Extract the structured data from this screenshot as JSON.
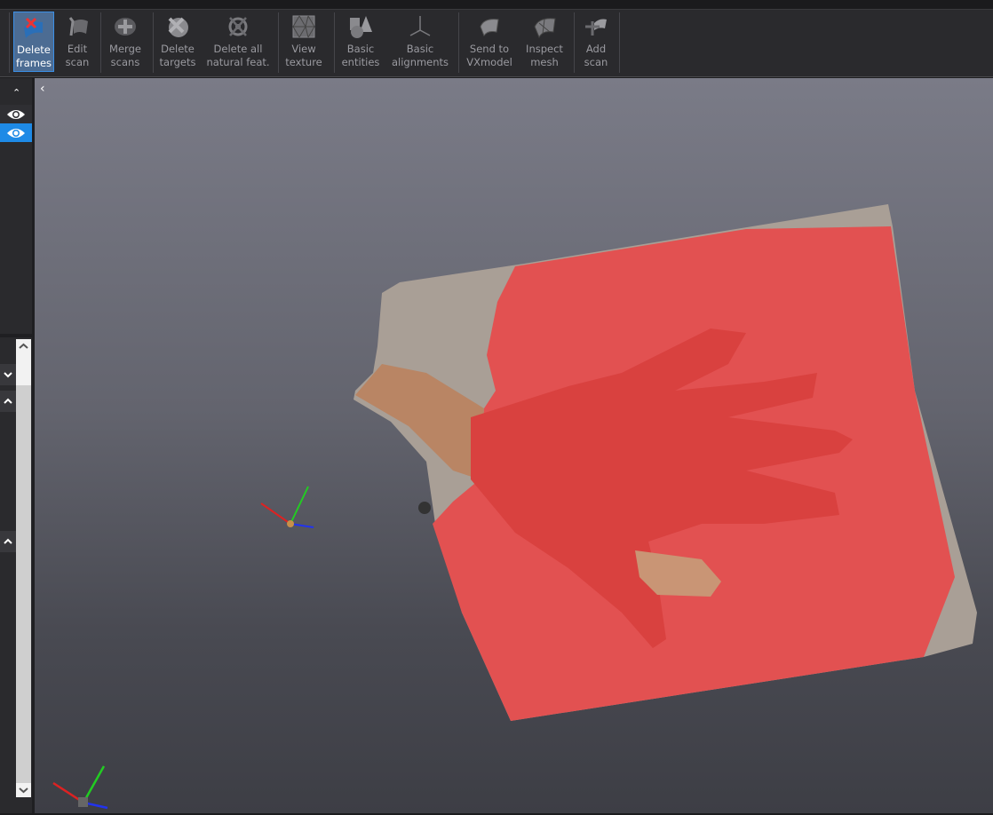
{
  "toolbar": {
    "buttons": [
      {
        "label": "Delete\nframes",
        "l1": "Delete",
        "l2": "frames",
        "icon": "delete-frames-icon",
        "active": true
      },
      {
        "l1": "Edit",
        "l2": "scan",
        "icon": "edit-scan-icon"
      },
      {
        "l1": "Merge",
        "l2": "scans",
        "icon": "merge-scans-icon"
      },
      {
        "l1": "Delete",
        "l2": "targets",
        "icon": "delete-targets-icon"
      },
      {
        "l1": "Delete all",
        "l2": "natural feat.",
        "icon": "delete-natural-features-icon"
      },
      {
        "l1": "View",
        "l2": "texture",
        "icon": "view-texture-icon"
      },
      {
        "l1": "Basic",
        "l2": "entities",
        "icon": "basic-entities-icon"
      },
      {
        "l1": "Basic",
        "l2": "alignments",
        "icon": "basic-alignments-icon"
      },
      {
        "l1": "Send to",
        "l2": "VXmodel",
        "icon": "send-to-vxmodel-icon"
      },
      {
        "l1": "Inspect",
        "l2": "mesh",
        "icon": "inspect-mesh-icon"
      },
      {
        "l1": "Add",
        "l2": "scan",
        "icon": "add-scan-icon"
      }
    ]
  },
  "colors": {
    "accent": "#1e8ae6",
    "selection": "#ff3c3c",
    "scan_gray": "#a99f96"
  },
  "left_panel": {
    "rows": [
      {
        "visible": true,
        "selected": false
      },
      {
        "visible": true,
        "selected": true
      }
    ]
  }
}
